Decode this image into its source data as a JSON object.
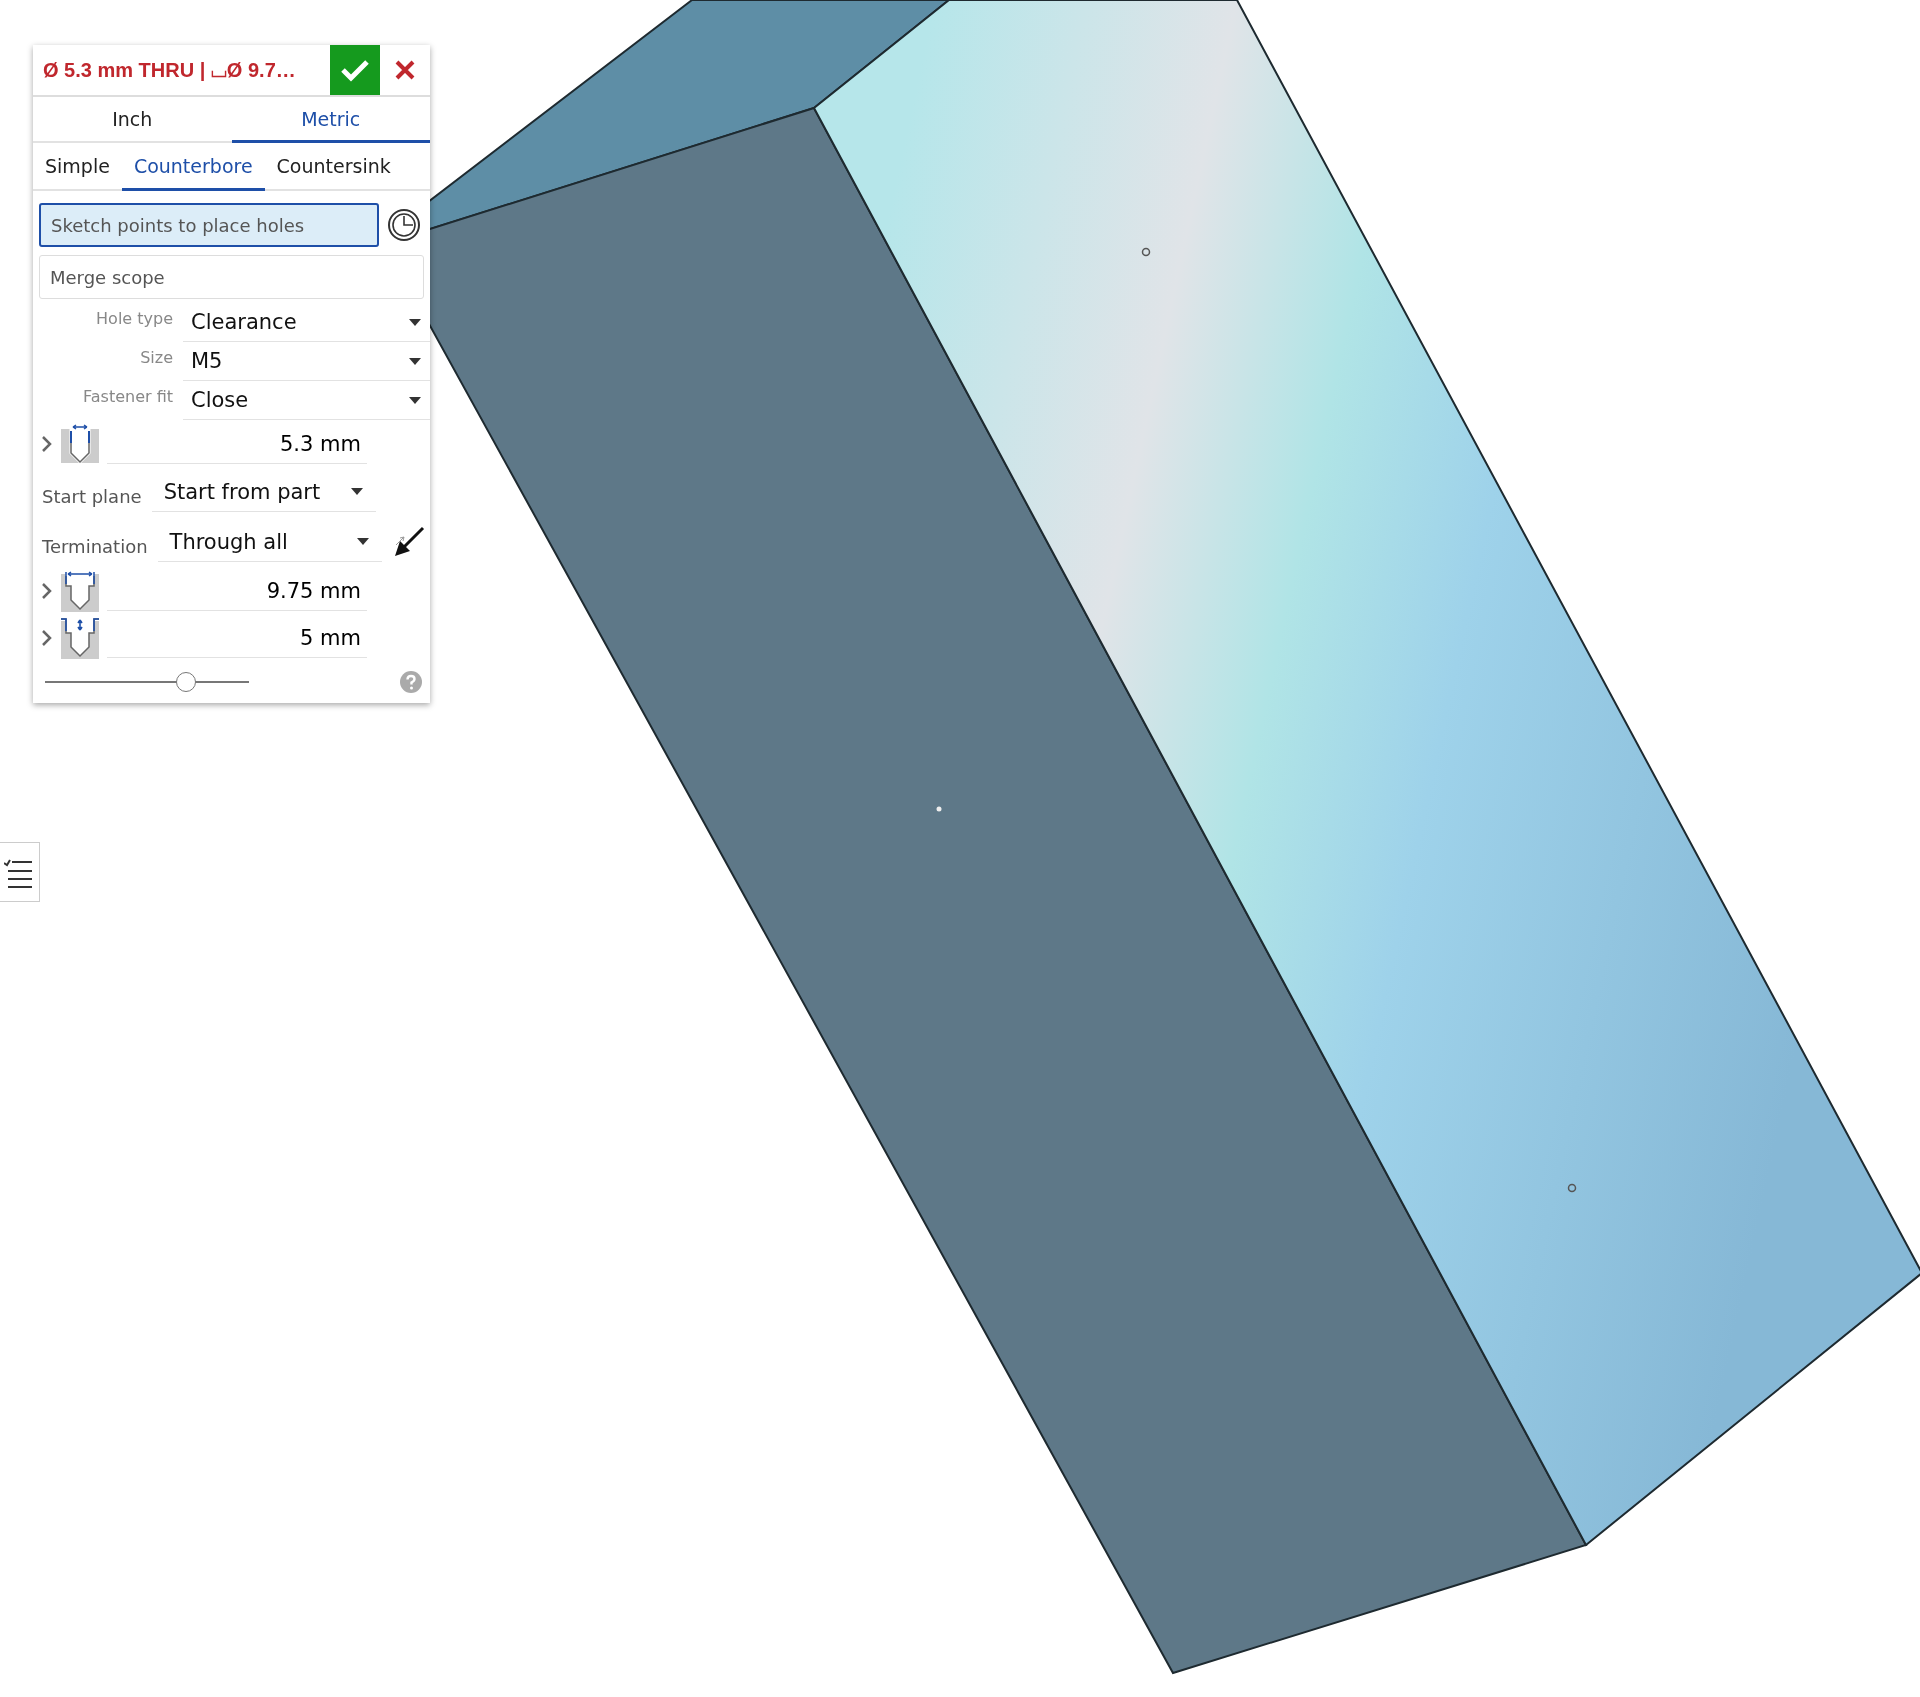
{
  "feature_dialog": {
    "title": "Ø 5.3 mm THRU | ⌴Ø 9.7…",
    "unit_tabs": [
      {
        "label": "Inch",
        "selected": false
      },
      {
        "label": "Metric",
        "selected": true
      }
    ],
    "style_tabs": [
      {
        "label": "Simple",
        "selected": false
      },
      {
        "label": "Counterbore",
        "selected": true
      },
      {
        "label": "Countersink",
        "selected": false
      }
    ],
    "selection_field": {
      "placeholder": "Sketch points to place holes",
      "active": true
    },
    "merge_scope": {
      "placeholder": "Merge scope"
    },
    "parameters": [
      {
        "kind": "select",
        "label": "Hole type",
        "value": "Clearance"
      },
      {
        "kind": "select",
        "label": "Size",
        "value": "M5"
      },
      {
        "kind": "select",
        "label": "Fastener fit",
        "value": "Close"
      },
      {
        "kind": "diameter",
        "value": "5.3 mm",
        "expanded": false
      },
      {
        "kind": "inline",
        "label": "Start plane",
        "value": "Start from part",
        "flip": false
      },
      {
        "kind": "inline",
        "label": "Termination",
        "value": "Through all",
        "flip": true
      },
      {
        "kind": "counterbore_diameter",
        "value": "9.75 mm",
        "expanded": false
      },
      {
        "kind": "counterbore_depth",
        "value": "5 mm",
        "expanded": false
      }
    ],
    "slider": {
      "level": 0.69
    }
  }
}
